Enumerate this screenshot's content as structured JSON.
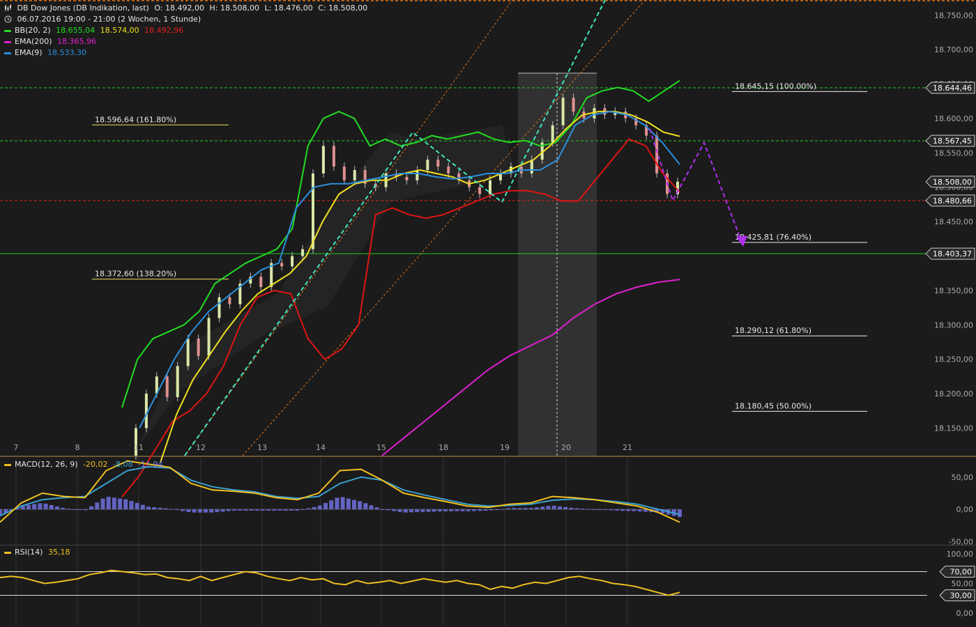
{
  "header": {
    "title": "DB Dow Jones (DB Indikation, last)",
    "ohlc": {
      "O": "O: 18.492,00",
      "H": "H: 18.508,00",
      "L": "L: 18.476,00",
      "C": "C: 18.508,00"
    },
    "period": "06.07.2016 19:00 - 21:00 (2 Wochen, 1 Stunde)"
  },
  "legend": {
    "bb": {
      "label": "BB(20, 2)",
      "upper": "18.655,04",
      "mid": "18.574,00",
      "lower": "18.492,96"
    },
    "ema200": {
      "label": "EMA(200)",
      "value": "18.365,96"
    },
    "ema9": {
      "label": "EMA(9)",
      "value": "18.533,30"
    },
    "macd": {
      "label": "MACD(12, 26, 9)",
      "macd": "-20,02",
      "signal": "-8,08",
      "hist": "-11,94"
    },
    "rsi": {
      "label": "RSI(14)",
      "value": "35,18"
    }
  },
  "colors": {
    "background": "#1b1b1b",
    "bb_upper": "#22dd22",
    "bb_mid": "#f0e020",
    "bb_lower": "#e01515",
    "ema200": "#e020d0",
    "ema9": "#2a90e0",
    "macd_line": "#f0c020",
    "macd_signal": "#3aa0d0",
    "macd_hist": "#7070e0",
    "rsi": "#f0c020",
    "trend_cyan": "#40e8c0",
    "channel_orange": "#e07820",
    "forecast_purple": "#b030f0",
    "current_price": "#ffffff",
    "level_green": "#22cc22",
    "level_red": "#dd2222"
  },
  "chart_data": {
    "type": "candlestick",
    "x_labels": [
      "7",
      "8",
      "11",
      "12",
      "13",
      "14",
      "15",
      "18",
      "19",
      "20",
      "21"
    ],
    "price_axis": {
      "ticks": [
        "18.750,00",
        "18.700,00",
        "18.650,00",
        "18.600,00",
        "18.550,00",
        "18.500,00",
        "18.450,00",
        "18.350,00",
        "18.300,00",
        "18.250,00",
        "18.200,00",
        "18.150,00"
      ],
      "tick_values": [
        18750,
        18700,
        18650,
        18600,
        18550,
        18500,
        18450,
        18350,
        18300,
        18250,
        18200,
        18150
      ],
      "ylim": [
        18110,
        18770
      ]
    },
    "price_markers": [
      {
        "label": "18.644,46",
        "value": 18644.46
      },
      {
        "label": "18.567,45",
        "value": 18567.45
      },
      {
        "label": "18.508,00",
        "value": 18508.0
      },
      {
        "label": "18.480,66",
        "value": 18480.66
      },
      {
        "label": "18.403,37",
        "value": 18403.37
      }
    ],
    "fibonacci": [
      {
        "label": "18.645,15 (100.00%)",
        "value": 18645.15
      },
      {
        "label": "18.596,64 (161.80%)",
        "value": 18596.64
      },
      {
        "label": "18.425,81 (76.40%)",
        "value": 18425.81
      },
      {
        "label": "18.372,60 (138.20%)",
        "value": 18372.6
      },
      {
        "label": "18.290,12 (61.80%)",
        "value": 18290.12
      },
      {
        "label": "18.180,45 (50.00%)",
        "value": 18180.45
      }
    ],
    "horizontal_levels": [
      {
        "value": 18644.46,
        "style": "dashed",
        "color": "green"
      },
      {
        "value": 18567.45,
        "style": "dashed",
        "color": "green"
      },
      {
        "value": 18480.66,
        "style": "dashed",
        "color": "red"
      },
      {
        "value": 18403.37,
        "style": "solid",
        "color": "green"
      }
    ],
    "close_series": [
      18110,
      18150,
      18200,
      18225,
      18195,
      18240,
      18280,
      18255,
      18310,
      18340,
      18330,
      18360,
      18370,
      18355,
      18390,
      18385,
      18400,
      18410,
      18520,
      18560,
      18530,
      18510,
      18525,
      18505,
      18500,
      18520,
      18515,
      18510,
      18525,
      18540,
      18530,
      18520,
      18510,
      18500,
      18490,
      18510,
      18520,
      18530,
      18520,
      18540,
      18565,
      18590,
      18630,
      18610,
      18600,
      18615,
      18605,
      18610,
      18600,
      18590,
      18575,
      18520,
      18490,
      18508
    ],
    "bb_upper": [
      18180,
      18250,
      18280,
      18290,
      18300,
      18320,
      18360,
      18375,
      18390,
      18400,
      18410,
      18440,
      18560,
      18600,
      18610,
      18600,
      18560,
      18570,
      18560,
      18565,
      18575,
      18570,
      18575,
      18580,
      18570,
      18565,
      18568,
      18560,
      18565,
      18590,
      18630,
      18640,
      18645,
      18640,
      18625,
      18640,
      18655
    ],
    "bb_mid": [
      18100,
      18170,
      18220,
      18255,
      18290,
      18320,
      18345,
      18360,
      18375,
      18400,
      18450,
      18490,
      18505,
      18510,
      18510,
      18520,
      18525,
      18520,
      18515,
      18505,
      18510,
      18520,
      18530,
      18540,
      18560,
      18585,
      18605,
      18610,
      18610,
      18605,
      18595,
      18580,
      18574
    ],
    "bb_lower": [
      18050,
      18080,
      18120,
      18160,
      18175,
      18200,
      18240,
      18300,
      18340,
      18350,
      18345,
      18280,
      18250,
      18265,
      18300,
      18460,
      18470,
      18460,
      18455,
      18460,
      18470,
      18480,
      18490,
      18495,
      18495,
      18490,
      18480,
      18480,
      18510,
      18540,
      18570,
      18560,
      18520,
      18493
    ],
    "ema9": [
      18150,
      18200,
      18250,
      18290,
      18320,
      18340,
      18360,
      18380,
      18390,
      18470,
      18500,
      18505,
      18505,
      18510,
      18515,
      18520,
      18520,
      18515,
      18512,
      18515,
      18520,
      18520,
      18525,
      18525,
      18540,
      18590,
      18605,
      18610,
      18605,
      18590,
      18565,
      18533
    ],
    "ema200": [
      18110,
      18135,
      18160,
      18185,
      18210,
      18235,
      18255,
      18270,
      18285,
      18310,
      18330,
      18345,
      18355,
      18362,
      18366
    ],
    "macd": {
      "axis_ticks": [
        "50,00",
        "0,00",
        "-50,00"
      ],
      "axis_values": [
        50,
        0,
        -50
      ],
      "ylim": [
        -55,
        80
      ],
      "macd_line": [
        -20,
        10,
        25,
        20,
        18,
        60,
        75,
        70,
        65,
        40,
        30,
        28,
        25,
        18,
        15,
        25,
        60,
        62,
        45,
        25,
        18,
        12,
        5,
        3,
        8,
        10,
        20,
        18,
        15,
        10,
        5,
        -5,
        -20
      ],
      "signal_line": [
        -10,
        5,
        15,
        18,
        20,
        40,
        60,
        66,
        64,
        45,
        35,
        30,
        27,
        20,
        17,
        20,
        40,
        50,
        45,
        30,
        22,
        15,
        8,
        5,
        6,
        8,
        14,
        16,
        15,
        12,
        8,
        0,
        -8
      ]
    },
    "rsi": {
      "axis_ticks": [
        "100,00",
        "70,00",
        "50,00",
        "30,00",
        "0,00"
      ],
      "axis_values": [
        100,
        70,
        50,
        30,
        0
      ],
      "ylim": [
        0,
        100
      ],
      "values": [
        60,
        62,
        60,
        55,
        50,
        52,
        55,
        58,
        65,
        68,
        72,
        70,
        68,
        65,
        66,
        60,
        58,
        55,
        62,
        55,
        60,
        65,
        70,
        68,
        62,
        58,
        55,
        60,
        56,
        58,
        50,
        48,
        55,
        50,
        52,
        55,
        50,
        54,
        58,
        55,
        52,
        55,
        50,
        48,
        40,
        45,
        42,
        48,
        52,
        50,
        55,
        60,
        62,
        58,
        55,
        50,
        48,
        45,
        40,
        35,
        30,
        35
      ]
    }
  }
}
